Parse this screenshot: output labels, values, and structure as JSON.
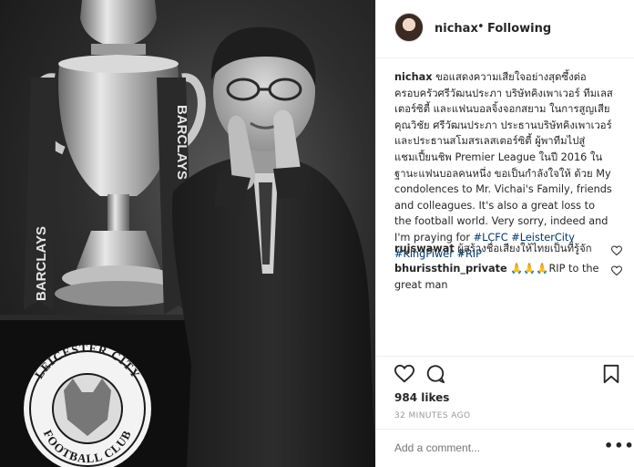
{
  "post": {
    "username": "nichax",
    "separator": "•",
    "follow_status": "Following",
    "caption": {
      "username": "nichax",
      "text": "ขอแสดงความเสียใจอย่างสุดซึ้งต่อครอบครัวศรีวัฒนประภา บริษัทคิงเพาเวอร์ ทีมเลสเตอร์ซิตี้ และแฟนบอลจิ้งจอกสยาม ในการสูญเสียคุณวิชัย ศรีวัฒนประภา ประธานบริษัทคิงเพาเวอร์และประธานสโมสรเลสเตอร์ซิตี้ ผู้พาทีมไปสู่แชมเปี้ยนชิพ Premier League ในปี 2016 ในฐานะแฟนบอลคนหนึ่ง ขอเป็นกำลังใจให้ ด้วย My condolences to Mr. Vichai's Family, friends and colleagues. It's also a great loss to the football world. Very sorry, indeed and I'm praying for",
      "hashtags": [
        "#LCFC",
        "#LeisterCity",
        "#KingPiwer",
        "#RIP"
      ]
    },
    "comments": [
      {
        "username": "rujswawat",
        "text": "ผู้สร้างชื่อเสียงให้ไทยเป็นที่รู้จัก"
      },
      {
        "username": "bhurissthin_private",
        "text": "🙏🙏🙏RIP to the great man"
      }
    ],
    "likes": "984 likes",
    "timestamp": "32 MINUTES AGO",
    "comment_placeholder": "Add a comment...",
    "more_label": "•••"
  },
  "photo": {
    "trophy_ribbon_text": "BARCLAYS",
    "crest_top_text": "LEICESTER CITY",
    "crest_bottom_text": "FOOTBALL CLUB"
  },
  "icons": {
    "like": "heart-icon",
    "comment": "comment-icon",
    "save": "bookmark-icon",
    "comment_like": "small-heart-icon"
  }
}
